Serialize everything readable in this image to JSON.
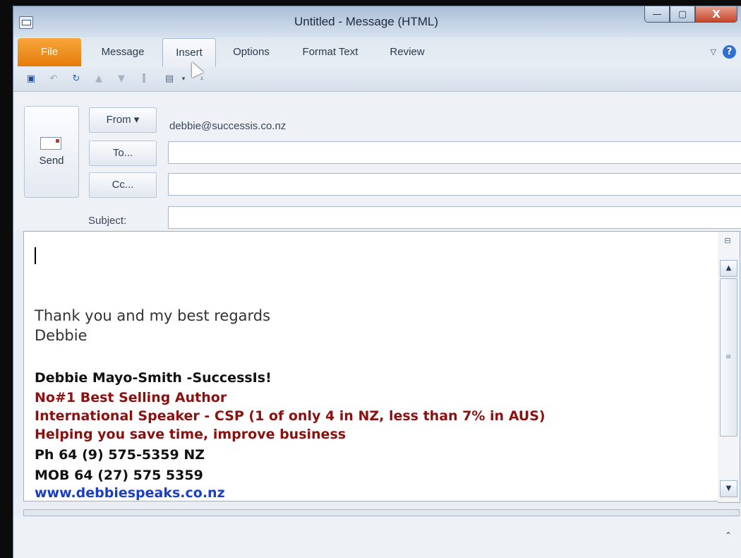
{
  "window": {
    "title": "Untitled  -  Message (HTML)",
    "controls": {
      "minimize": "—",
      "maximize": "▢",
      "close": "X"
    }
  },
  "tabs": [
    {
      "label": "File"
    },
    {
      "label": "Message"
    },
    {
      "label": "Insert"
    },
    {
      "label": "Options"
    },
    {
      "label": "Format Text"
    },
    {
      "label": "Review"
    }
  ],
  "help": {
    "label": "?"
  },
  "header": {
    "send_label": "Send",
    "from_label": "From ▾",
    "from_value": "debbie@successis.co.nz",
    "to_label": "To...",
    "cc_label": "Cc...",
    "subject_label": "Subject:",
    "to_value": "",
    "cc_value": "",
    "subject_value": ""
  },
  "body": {
    "line1": "Thank you and my best regards",
    "line2": "Debbie",
    "sig_name": "Debbie Mayo-Smith -SuccessIs!",
    "sig_title1": "No#1 Best Selling Author",
    "sig_title2": "International Speaker - CSP (1 of only 4 in NZ, less than 7% in AUS)",
    "sig_title3": "Helping you save time, improve business",
    "sig_phone": "Ph 64 (9) 575-5359 NZ",
    "sig_mobile": "MOB 64 (27) 575 5359",
    "sig_web": "www.debbiespeaks.co.nz"
  },
  "colors": {
    "file_tab": "#e57c0d",
    "signature_maroon": "#8b1010",
    "link_blue": "#1a3fc4"
  }
}
